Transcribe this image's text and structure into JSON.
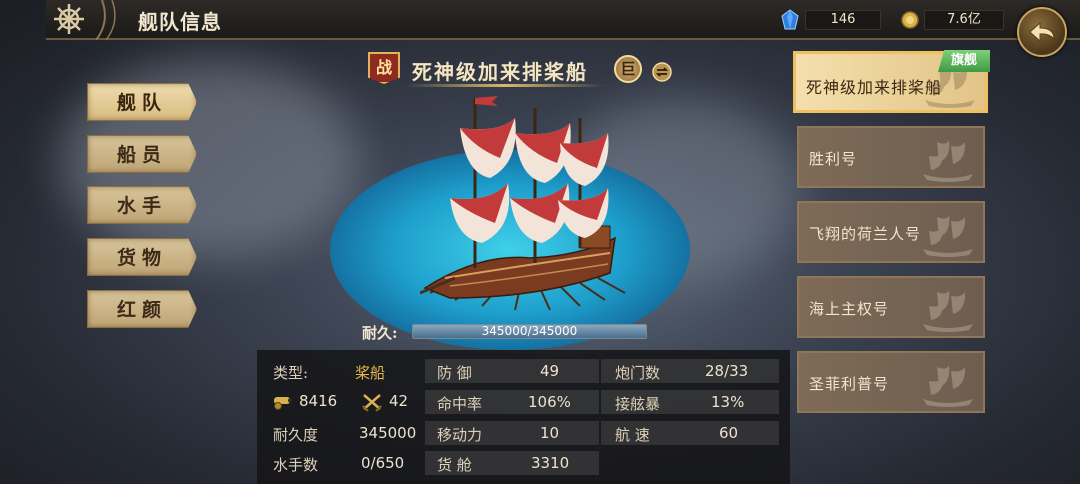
{
  "header": {
    "title": "舰队信息",
    "gems": "146",
    "gold": "7.6亿"
  },
  "menu": [
    {
      "label": "舰队",
      "active": true
    },
    {
      "label": "船员",
      "active": false
    },
    {
      "label": "水手",
      "active": false
    },
    {
      "label": "货物",
      "active": false
    },
    {
      "label": "红颜",
      "active": false
    }
  ],
  "ship": {
    "battle_badge": "战",
    "name": "死神级加来排桨船",
    "size_badge": "巨",
    "durability_label": "耐久:",
    "durability_text": "345000/345000",
    "durability_fraction": 1.0
  },
  "stats": {
    "type_label": "类型:",
    "type_value": "桨船",
    "stat_a_value": "8416",
    "stat_b_value": "42",
    "durability_label": "耐久度",
    "durability_value": "345000",
    "sailors_label": "水手数",
    "sailors_value": "0/650",
    "defense_label": "防 御",
    "defense_value": "49",
    "accuracy_label": "命中率",
    "accuracy_value": "106%",
    "mobility_label": "移动力",
    "mobility_value": "10",
    "cargo_label": "货 舱",
    "cargo_value": "3310",
    "cannons_label": "炮门数",
    "cannons_value": "28/33",
    "boarding_label": "接舷暴",
    "boarding_value": "13%",
    "speed_label": "航 速",
    "speed_value": "60"
  },
  "ship_list": {
    "flagship_tag": "旗舰",
    "items": [
      {
        "name": "死神级加来排桨船",
        "selected": true
      },
      {
        "name": "胜利号",
        "selected": false
      },
      {
        "name": "飞翔的荷兰人号",
        "selected": false
      },
      {
        "name": "海上主权号",
        "selected": false
      },
      {
        "name": "圣菲利普号",
        "selected": false
      }
    ]
  },
  "colors": {
    "accent_gold": "#d8b86b",
    "sail_red": "#c23a3a",
    "ocean_blue": "#1e9fcc",
    "flagship_green": "#3f9a45"
  }
}
